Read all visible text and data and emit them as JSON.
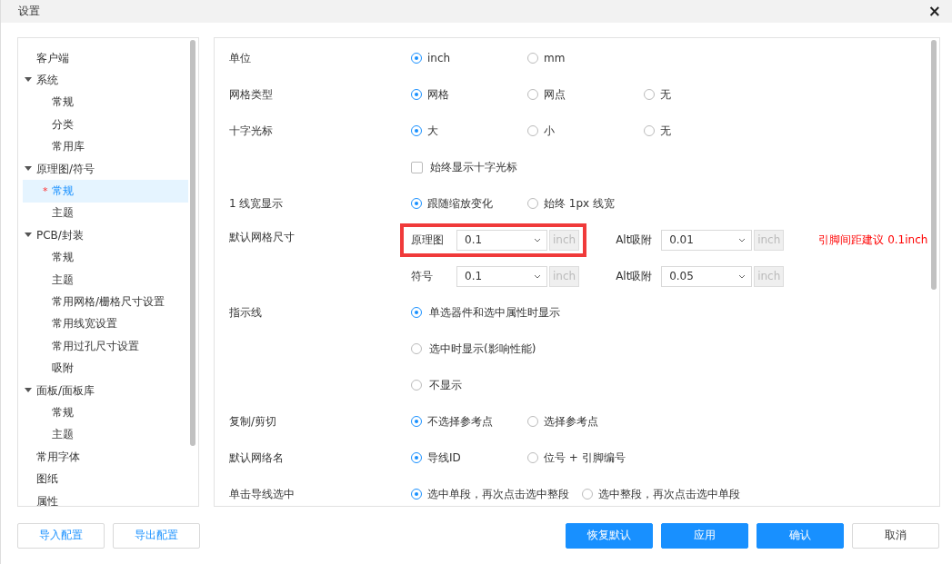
{
  "window": {
    "title": "设置",
    "close": "×"
  },
  "sidebar": {
    "items": [
      {
        "label": "客户端",
        "selected": false
      },
      {
        "label": "系统",
        "expanded": true,
        "selected": false,
        "children": [
          {
            "label": "常规",
            "selected": false
          },
          {
            "label": "分类",
            "selected": false
          },
          {
            "label": "常用库",
            "selected": false
          }
        ]
      },
      {
        "label": "原理图/符号",
        "expanded": true,
        "selected": false,
        "children": [
          {
            "label": "常规",
            "selected": true,
            "marker": "*"
          },
          {
            "label": "主题",
            "selected": false
          }
        ]
      },
      {
        "label": "PCB/封装",
        "expanded": true,
        "selected": false,
        "children": [
          {
            "label": "常规",
            "selected": false
          },
          {
            "label": "主题",
            "selected": false
          },
          {
            "label": "常用网格/栅格尺寸设置",
            "selected": false
          },
          {
            "label": "常用线宽设置",
            "selected": false
          },
          {
            "label": "常用过孔尺寸设置",
            "selected": false
          },
          {
            "label": "吸附",
            "selected": false
          }
        ]
      },
      {
        "label": "面板/面板库",
        "expanded": true,
        "selected": false,
        "children": [
          {
            "label": "常规",
            "selected": false
          },
          {
            "label": "主题",
            "selected": false
          }
        ]
      },
      {
        "label": "常用字体",
        "selected": false
      },
      {
        "label": "图纸",
        "selected": false
      },
      {
        "label": "属性",
        "selected": false
      }
    ]
  },
  "settings": [
    {
      "kind": "radio",
      "label": "单位",
      "options": [
        {
          "label": "inch",
          "selected": true
        },
        {
          "label": "mm",
          "selected": false
        }
      ]
    },
    {
      "kind": "radio",
      "label": "网格类型",
      "options": [
        {
          "label": "网格",
          "selected": true
        },
        {
          "label": "网点",
          "selected": false
        },
        {
          "label": "无",
          "selected": false
        }
      ]
    },
    {
      "kind": "radio",
      "label": "十字光标",
      "options": [
        {
          "label": "大",
          "selected": true
        },
        {
          "label": "小",
          "selected": false
        },
        {
          "label": "无",
          "selected": false
        }
      ]
    },
    {
      "kind": "checkbox",
      "text": "始终显示十字光标",
      "checked": false
    },
    {
      "kind": "radio",
      "label": "1 线宽显示",
      "options": [
        {
          "label": "跟随缩放变化",
          "selected": true
        },
        {
          "label": "始终 1px 线宽",
          "selected": false
        }
      ]
    },
    {
      "kind": "sizes",
      "label": "默认网格尺寸",
      "rows": [
        {
          "label": "原理图",
          "value": "0.1",
          "unit": "inch",
          "highlighted": true,
          "alt_label": "Alt吸附",
          "alt_value": "0.01",
          "alt_unit": "inch",
          "hint": "引脚间距建议 0.1inch"
        },
        {
          "label": "符号",
          "value": "0.1",
          "unit": "inch",
          "highlighted": false,
          "alt_label": "Alt吸附",
          "alt_value": "0.05",
          "alt_unit": "inch"
        }
      ]
    },
    {
      "kind": "radio-stack",
      "label": "指示线",
      "options": [
        {
          "label": "单选器件和选中属性时显示",
          "selected": true
        },
        {
          "label": "选中时显示(影响性能)",
          "selected": false
        },
        {
          "label": "不显示",
          "selected": false
        }
      ]
    },
    {
      "kind": "radio",
      "label": "复制/剪切",
      "options": [
        {
          "label": "不选择参考点",
          "selected": true
        },
        {
          "label": "选择参考点",
          "selected": false
        }
      ]
    },
    {
      "kind": "radio",
      "label": "默认网络名",
      "options": [
        {
          "label": "导线ID",
          "selected": true
        },
        {
          "label": "位号 + 引脚编号",
          "selected": false
        }
      ]
    },
    {
      "kind": "radio",
      "label": "单击导线选中",
      "options": [
        {
          "label": "选中单段，再次点击选中整段",
          "selected": true
        },
        {
          "label": "选中整段，再次点击选中单段",
          "selected": false
        }
      ]
    }
  ],
  "footer": {
    "left_buttons": [
      {
        "label": "导入配置",
        "kind": "outline"
      },
      {
        "label": "导出配置",
        "kind": "outline"
      }
    ],
    "right_buttons": [
      {
        "label": "恢复默认",
        "kind": "primary"
      },
      {
        "label": "应用",
        "kind": "primary"
      },
      {
        "label": "确认",
        "kind": "primary"
      },
      {
        "label": "取消",
        "kind": "default"
      }
    ]
  }
}
